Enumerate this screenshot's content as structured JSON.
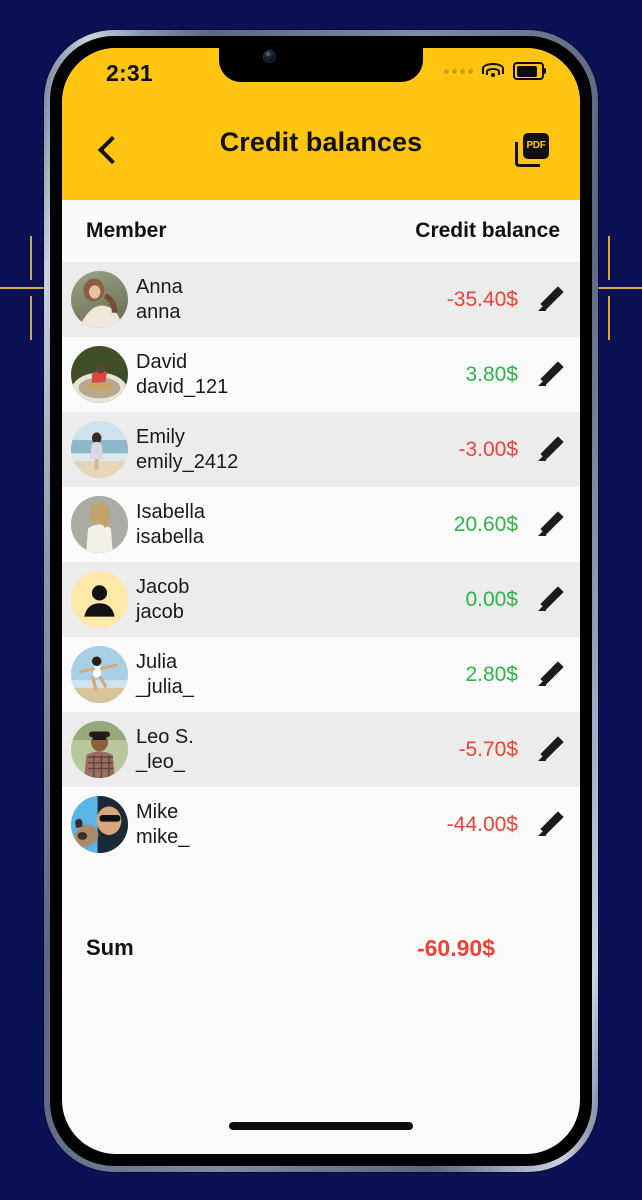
{
  "status_bar": {
    "time": "2:31",
    "cellular_icon": "cellular-dots-icon",
    "wifi_icon": "wifi-icon",
    "battery_icon": "battery-full-icon"
  },
  "nav": {
    "back_icon": "chevron-left-icon",
    "title": "Credit balances",
    "pdf_icon": "pdf-export-icon",
    "pdf_label": "PDF"
  },
  "table": {
    "columns": {
      "member": "Member",
      "balance": "Credit balance"
    },
    "rows": [
      {
        "name": "Anna",
        "username": "anna",
        "amount": "-35.40$",
        "sign": "neg",
        "avatar": "photo-anna"
      },
      {
        "name": "David",
        "username": "david_121",
        "amount": "3.80$",
        "sign": "pos",
        "avatar": "photo-david"
      },
      {
        "name": "Emily",
        "username": "emily_2412",
        "amount": "-3.00$",
        "sign": "neg",
        "avatar": "photo-emily"
      },
      {
        "name": "Isabella",
        "username": "isabella",
        "amount": "20.60$",
        "sign": "pos",
        "avatar": "photo-isabella"
      },
      {
        "name": "Jacob",
        "username": "jacob",
        "amount": "0.00$",
        "sign": "pos",
        "avatar": "placeholder-person"
      },
      {
        "name": "Julia",
        "username": "_julia_",
        "amount": "2.80$",
        "sign": "pos",
        "avatar": "photo-julia"
      },
      {
        "name": "Leo S.",
        "username": "_leo_",
        "amount": "-5.70$",
        "sign": "neg",
        "avatar": "photo-leo"
      },
      {
        "name": "Mike",
        "username": "mike_",
        "amount": "-44.00$",
        "sign": "neg",
        "avatar": "photo-mike"
      }
    ],
    "edit_icon": "edit-pencil-icon"
  },
  "summary": {
    "label": "Sum",
    "value": "-60.90$"
  },
  "colors": {
    "brand_yellow": "#ffc510",
    "negative": "#ef4136",
    "positive": "#2eb34a",
    "row_odd": "#ececec",
    "row_even": "#fbfbfb",
    "backdrop": "#0a1155",
    "accent_gold": "#d8a441"
  }
}
